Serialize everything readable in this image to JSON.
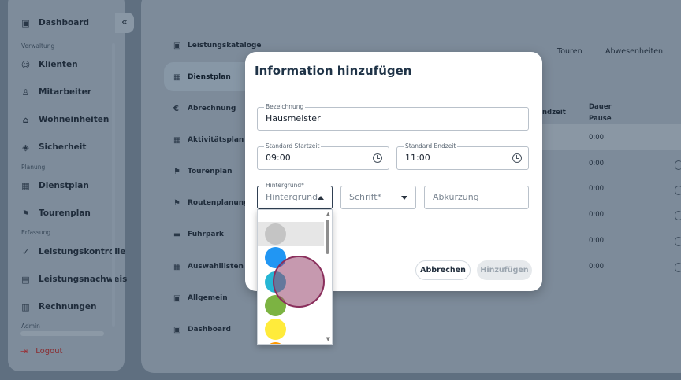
{
  "sidebar": {
    "dashboard": "Dashboard",
    "collapse_icon": "«",
    "sections": {
      "verwaltung": "Verwaltung",
      "planung": "Planung",
      "erfassung": "Erfassung",
      "admin": "Admin"
    },
    "items": {
      "klienten": "Klienten",
      "mitarbeiter": "Mitarbeiter",
      "wohneinheiten": "Wohneinheiten",
      "sicherheit": "Sicherheit",
      "dienstplan": "Dienstplan",
      "tourenplan": "Tourenplan",
      "leistungskontrolle": "Leistungskontrolle",
      "leistungsnachweis": "Leistungsnachweis",
      "rechnungen": "Rechnungen"
    },
    "logout": "Logout"
  },
  "subnav": {
    "leistungskataloge": "Leistungskataloge",
    "dienstplan": "Dienstplan",
    "abrechnung": "Abrechnung",
    "aktivitaetsplan": "Aktivitätsplan",
    "tourenplan": "Tourenplan",
    "routenplanung": "Routenplanung",
    "fuhrpark": "Fuhrpark",
    "auswahllisten": "Auswahllisten",
    "allgemein": "Allgemein",
    "dashboard": "Dashboard"
  },
  "tabs": {
    "touren": "Touren",
    "abwesenheiten": "Abwesenheiten"
  },
  "table": {
    "col_endzeit": "ndzeit",
    "col_dauer": "Dauer",
    "col_pause": "Pause",
    "rows": [
      "0:00",
      "0:00",
      "0:00",
      "0:00",
      "0:00",
      "0:00"
    ]
  },
  "modal": {
    "title": "Information hinzufügen",
    "bezeichnung_label": "Bezeichnung",
    "bezeichnung_value": "Hausmeister",
    "start_label": "Standard Startzeit",
    "start_value": "09:00",
    "end_label": "Standard Endzeit",
    "end_value": "11:00",
    "hintergrund_label": "Hintergrund*",
    "hintergrund_placeholder": "Hintergrund",
    "schrift_placeholder": "Schrift*",
    "abkuerzung_placeholder": "Abkürzung",
    "cancel_label": "Abbrechen",
    "add_label": "Hinzufügen"
  },
  "color_options": [
    "#c4c4c4",
    "#2196f3",
    "#26b6d4",
    "#7cb342",
    "#ffeb3b",
    "#ff9800"
  ],
  "colors": {
    "accent": "#1f3347",
    "logout": "#8a2c30"
  }
}
